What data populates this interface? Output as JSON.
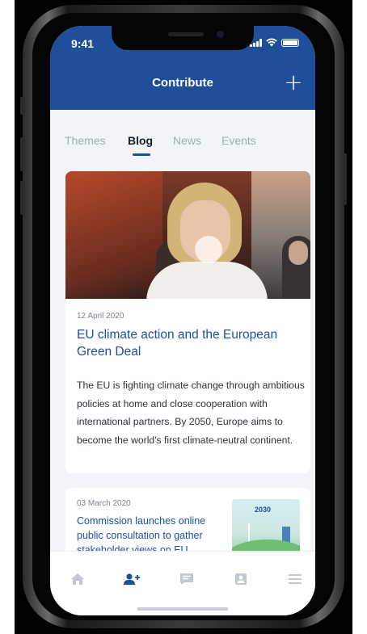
{
  "status_bar": {
    "time": "9:41"
  },
  "header": {
    "title": "Contribute",
    "add_label": "+"
  },
  "tabs": [
    {
      "label": "Themes",
      "active": false
    },
    {
      "label": "Blog",
      "active": true
    },
    {
      "label": "News",
      "active": false
    },
    {
      "label": "Events",
      "active": false
    }
  ],
  "feed": [
    {
      "date": "12 April 2020",
      "title": "EU climate action and the European Green Deal",
      "body": "The EU is fighting climate change through ambitious policies at home and close cooperation with international partners. By 2050, Europe aims to become the world's first climate-neutral continent."
    },
    {
      "date": "03 March 2020",
      "title": "Commission launches online public consultation to gather stakeholder views on EU",
      "thumbnail_text": "2030"
    }
  ],
  "bottom_nav": [
    {
      "icon": "home-icon",
      "active": false
    },
    {
      "icon": "add-user-icon",
      "active": true
    },
    {
      "icon": "comment-icon",
      "active": false
    },
    {
      "icon": "contact-icon",
      "active": false
    },
    {
      "icon": "menu-icon",
      "active": false
    }
  ],
  "colors": {
    "brand": "#1f4e9a",
    "inactive_tab": "#a4a9b4",
    "nav_inactive": "#c3c7cf",
    "nav_active": "#1f4e9a"
  }
}
